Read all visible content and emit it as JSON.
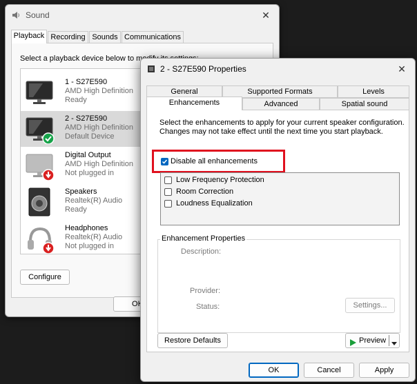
{
  "sound": {
    "title": "Sound",
    "tabs": [
      "Playback",
      "Recording",
      "Sounds",
      "Communications"
    ],
    "instruction": "Select a playback device below to modify its settings:",
    "devices": [
      {
        "name": "1 - S27E590",
        "driver": "AMD High Definition",
        "status": "Ready",
        "icon": "monitor-icon"
      },
      {
        "name": "2 - S27E590",
        "driver": "AMD High Definition",
        "status": "Default Device",
        "icon": "monitor-default-icon"
      },
      {
        "name": "Digital Output",
        "driver": "AMD High Definition",
        "status": "Not plugged in",
        "icon": "monitor-unplugged-icon"
      },
      {
        "name": "Speakers",
        "driver": "Realtek(R) Audio",
        "status": "Ready",
        "icon": "speaker-icon"
      },
      {
        "name": "Headphones",
        "driver": "Realtek(R) Audio",
        "status": "Not plugged in",
        "icon": "headphones-unplugged-icon"
      }
    ],
    "configure": "Configure",
    "ok": "OK"
  },
  "props": {
    "title": "2 - S27E590 Properties",
    "tabs_row1": [
      "General",
      "Supported Formats",
      "Levels"
    ],
    "tabs_row2": [
      "Enhancements",
      "Advanced",
      "Spatial sound"
    ],
    "intro": "Select the enhancements to apply for your current speaker configuration. Changes may not take effect until the next time you start playback.",
    "disable_all": "Disable all enhancements",
    "disable_all_checked": true,
    "enhancements": [
      "Low Frequency Protection",
      "Room Correction",
      "Loudness Equalization"
    ],
    "group_title": "Enhancement Properties",
    "description_label": "Description:",
    "provider_label": "Provider:",
    "status_label": "Status:",
    "settings_btn": "Settings...",
    "restore_defaults": "Restore Defaults",
    "preview": "Preview",
    "ok": "OK",
    "cancel": "Cancel",
    "apply": "Apply"
  },
  "colors": {
    "highlight": "#e0101e",
    "accent": "#0067c0",
    "check_badge": "#17a34a",
    "unplugged_badge": "#d92020"
  }
}
